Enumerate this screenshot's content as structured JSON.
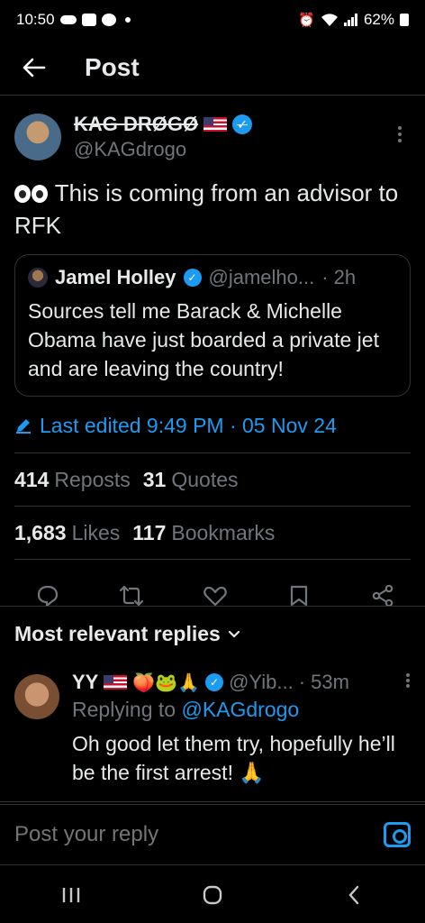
{
  "status_bar": {
    "time": "10:50",
    "battery": "62%"
  },
  "header": {
    "title": "Post"
  },
  "post": {
    "display_name": "KAG DRØGØ",
    "handle": "@KAGdrogo",
    "text": "This is coming from an advisor to RFK",
    "quote": {
      "name": "Jamel Holley",
      "handle": "@jamelho...",
      "time": "· 2h",
      "text": "Sources tell me Barack & Michelle Obama have just boarded a private jet and are leaving the country!"
    },
    "edited": "Last edited 9:49 PM · 05 Nov 24",
    "stats": {
      "reposts_count": "414",
      "reposts_label": "Reposts",
      "quotes_count": "31",
      "quotes_label": "Quotes",
      "likes_count": "1,683",
      "likes_label": "Likes",
      "bookmarks_count": "117",
      "bookmarks_label": "Bookmarks"
    }
  },
  "replies": {
    "header": "Most relevant replies",
    "items": [
      {
        "name": "YY",
        "emojis": "🍑🐸🙏",
        "handle": "@Yib...",
        "time": "· 53m",
        "replying_to_label": "Replying to",
        "replying_to_handle": "@KAGdrogo",
        "text": "Oh good let them try, hopefully he’ll be the first arrest! 🙏"
      }
    ]
  },
  "composer": {
    "placeholder": "Post your reply"
  },
  "colors": {
    "accent": "#1d9bf0",
    "background": "#000000",
    "muted": "#71767b"
  }
}
